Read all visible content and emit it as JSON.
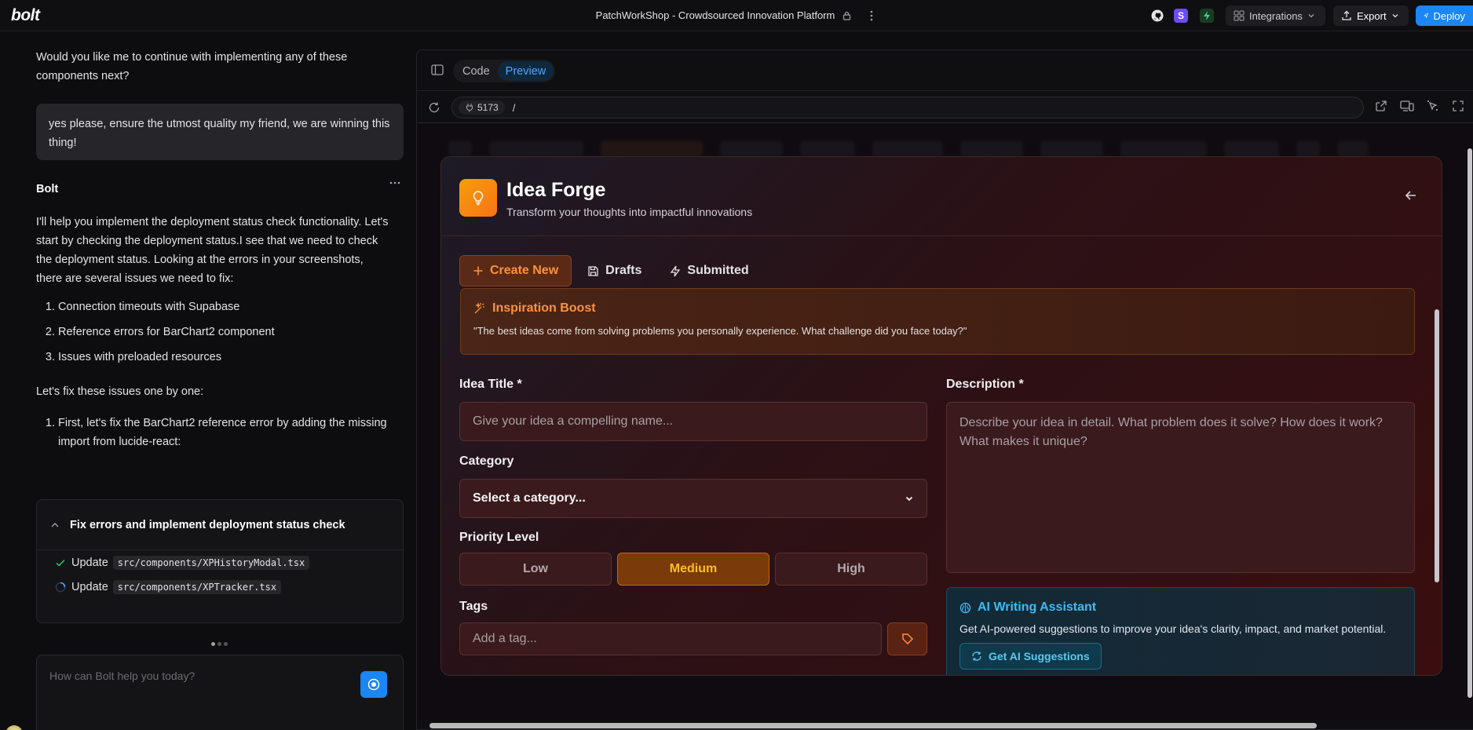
{
  "app": {
    "logo": "bolt",
    "project_title": "PatchWorkShop - Crowdsourced Innovation Platform",
    "integrations_label": "Integrations",
    "export_label": "Export",
    "deploy_label": "Deploy",
    "s_badge": "S",
    "accent": "#1b86f5"
  },
  "chat": {
    "intro_question": "Would you like me to continue with implementing any of these components next?",
    "user_message": "yes please, ensure the utmost quality my friend, we are winning this thing!",
    "assistant_name": "Bolt",
    "assistant_para1": "I'll help you implement the deployment status check functionality. Let's start by checking the deployment status.I see that we need to check the deployment status. Looking at the errors in your screenshots, there are several issues we need to fix:",
    "issues": [
      "Connection timeouts with Supabase",
      "Reference errors for BarChart2 component",
      "Issues with preloaded resources"
    ],
    "fix_intro": "Let's fix these issues one by one:",
    "fix_steps": [
      "First, let's fix the BarChart2 reference error by adding the missing import from lucide-react:"
    ],
    "artifact": {
      "title": "Fix errors and implement deployment status check",
      "actions": [
        {
          "verb": "Update",
          "file": "src/components/XPHistoryModal.tsx",
          "status": "done"
        },
        {
          "verb": "Update",
          "file": "src/components/XPTracker.tsx",
          "status": "running"
        }
      ]
    },
    "prompt_placeholder": "How can Bolt help you today?"
  },
  "workbench": {
    "tabs": [
      {
        "label": "Code",
        "active": false
      },
      {
        "label": "Preview",
        "active": true
      }
    ],
    "port": "5173",
    "path": "/"
  },
  "modal": {
    "title": "Idea Forge",
    "subtitle": "Transform your thoughts into impactful innovations",
    "tabs": [
      {
        "label": "Create New",
        "icon": "plus-icon",
        "active": true
      },
      {
        "label": "Drafts",
        "icon": "save-icon",
        "active": false
      },
      {
        "label": "Submitted",
        "icon": "zap-icon",
        "active": false
      }
    ],
    "inspiration": {
      "title": "Inspiration Boost",
      "quote": "\"The best ideas come from solving problems you personally experience. What challenge did you face today?\""
    },
    "idea_title": {
      "label": "Idea Title *",
      "placeholder": "Give your idea a compelling name..."
    },
    "category": {
      "label": "Category",
      "selected": "Select a category..."
    },
    "priority": {
      "label": "Priority Level",
      "options": [
        "Low",
        "Medium",
        "High"
      ],
      "selected": "Medium"
    },
    "tags": {
      "label": "Tags",
      "placeholder": "Add a tag..."
    },
    "description": {
      "label": "Description *",
      "placeholder": "Describe your idea in detail. What problem does it solve? How does it work? What makes it unique?"
    },
    "ai_assistant": {
      "title": "AI Writing Assistant",
      "description": "Get AI-powered suggestions to improve your idea's clarity, impact, and market potential.",
      "button": "Get AI Suggestions"
    }
  }
}
